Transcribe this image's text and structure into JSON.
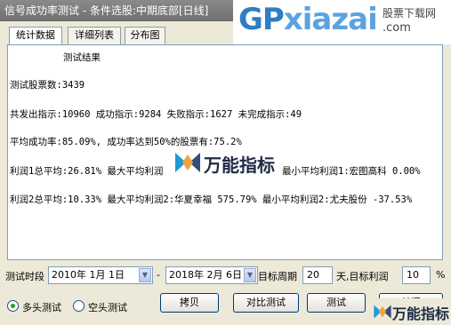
{
  "window": {
    "title": "信号成功率测试 - 条件选股:中期底部[日线]",
    "close_label": "X"
  },
  "watermark": {
    "site_brand_gp": "GP",
    "site_brand_rest": "xiazai",
    "site_cn": "股票下载网",
    "site_url": ".com",
    "logo_text": "万能指标"
  },
  "tabs": [
    {
      "label": "统计数据",
      "active": true
    },
    {
      "label": "详细列表",
      "active": false
    },
    {
      "label": "分布图",
      "active": false
    }
  ],
  "results": {
    "heading": "测试结果",
    "lines": [
      "测试股票数:3439",
      "共发出指示:10960 成功指示:9284 失败指示:1627 未完成指示:49",
      "平均成功率:85.09%, 成功率达到50%的股票有:75.2%",
      "利润1总平均:26.81% 最大平均利润",
      "最小平均利润1:宏图高科 0.00%",
      "利润2总平均:10.33% 最大平均利润2:华夏幸福 575.79% 最小平均利润2:尤夫股份 -37.53%"
    ]
  },
  "params": {
    "period_label": "测试时段",
    "start_date": "2010年 1月 1日",
    "dash": "-",
    "end_date": "2018年 2月 6日",
    "target_period_label": "目标周期",
    "target_period_value": "20",
    "target_profit_label": "天,目标利润",
    "target_profit_value": "10",
    "percent_label": "%"
  },
  "radios": [
    {
      "label": "多头测试",
      "checked": true
    },
    {
      "label": "空头测试",
      "checked": false
    }
  ],
  "buttons": {
    "copy": "拷贝",
    "compare": "对比测试",
    "test": "测试",
    "close": "关闭"
  }
}
